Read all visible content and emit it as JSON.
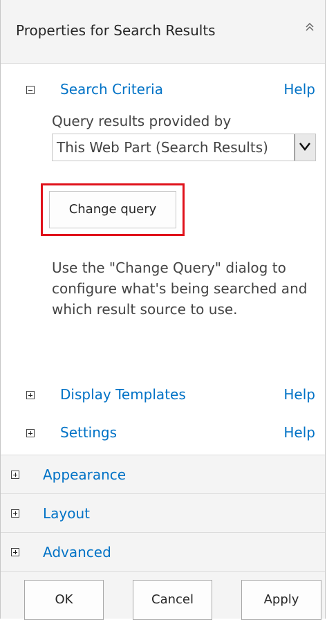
{
  "header": {
    "title": "Properties for Search Results",
    "collapse_icon": "double-chevron-up-icon"
  },
  "search_criteria": {
    "title": "Search Criteria",
    "help": "Help",
    "query_label": "Query results provided by",
    "query_select_value": "This Web Part (Search Results)",
    "change_query_label": "Change query",
    "description": "Use the \"Change Query\" dialog to configure what's being searched and which result source to use."
  },
  "display_templates": {
    "title": "Display Templates",
    "help": "Help"
  },
  "settings": {
    "title": "Settings",
    "help": "Help"
  },
  "appearance": {
    "title": "Appearance"
  },
  "layout": {
    "title": "Layout"
  },
  "advanced": {
    "title": "Advanced"
  },
  "footer": {
    "ok": "OK",
    "cancel": "Cancel",
    "apply": "Apply"
  },
  "colors": {
    "link": "#0072c6",
    "highlight_border": "#e0121b",
    "band_bg": "#f4f4f4"
  }
}
